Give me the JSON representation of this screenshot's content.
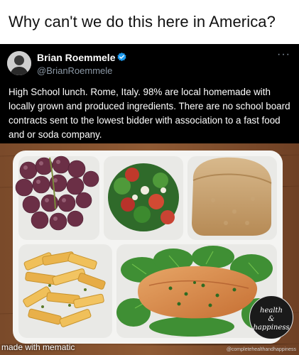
{
  "caption": "Why can't we do this here in America?",
  "tweet": {
    "author_name": "Brian Roemmele",
    "author_handle": "@BrianRoemmele",
    "verified_icon": "verified-badge-icon",
    "more_label": "···",
    "text": "High School lunch. Rome, Italy. 98% are local homemade with locally grown and produced ingredients. There are no school board contracts sent to the lowest bidder with association to a fast food and or soda company."
  },
  "photo": {
    "subject": "lunch-tray-photo"
  },
  "watermarks": {
    "meme_generator": "made with mematic",
    "logo_line1": "health",
    "logo_line2": "&",
    "logo_line3": "happiness",
    "source_url": "@completehealthandhappiness"
  },
  "colors": {
    "tweet_bg": "#000000",
    "verified": "#1d9bf0",
    "handle": "#8b98a5"
  }
}
